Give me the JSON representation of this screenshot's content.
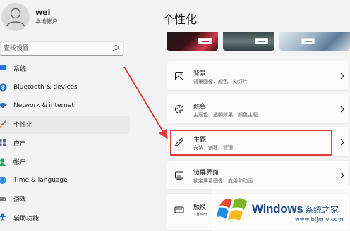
{
  "user": {
    "name": "wei",
    "account_type": "本地帐户"
  },
  "search": {
    "placeholder": "查找设置"
  },
  "sidebar": {
    "items": [
      {
        "label": "系统",
        "icon": "system-icon",
        "active": false
      },
      {
        "label": "Bluetooth & devices",
        "icon": "bluetooth-icon",
        "active": false
      },
      {
        "label": "Network & internet",
        "icon": "network-icon",
        "active": false
      },
      {
        "label": "个性化",
        "icon": "brush-icon",
        "active": true
      },
      {
        "label": "应用",
        "icon": "apps-icon",
        "active": false
      },
      {
        "label": "帐户",
        "icon": "account-icon",
        "active": false
      },
      {
        "label": "Time & language",
        "icon": "globe-icon",
        "active": false
      },
      {
        "label": "游戏",
        "icon": "gaming-icon",
        "active": false
      },
      {
        "label": "辅助功能",
        "icon": "accessibility-icon",
        "active": false
      }
    ]
  },
  "main": {
    "title": "个性化",
    "cards": [
      {
        "title": "背景",
        "subtitle": "背景图像、颜色、幻灯片",
        "icon": "image-icon"
      },
      {
        "title": "颜色",
        "subtitle": "主题色、透明效果、颜色主题",
        "icon": "palette-icon"
      },
      {
        "title": "主题",
        "subtitle": "安装、创建、管理",
        "icon": "pen-icon"
      },
      {
        "title": "锁屏界面",
        "subtitle": "锁定屏幕图像、应用和动画",
        "icon": "lockscreen-icon"
      },
      {
        "title": "触摸",
        "subtitle": "Them",
        "icon": "keyboard-icon"
      }
    ]
  },
  "watermark": {
    "brand": "Windows",
    "site_cn": "系统之家",
    "url": "www.bjjmlv.com"
  },
  "colors": {
    "accent_red": "#e0393e",
    "highlight_border": "#e0393e",
    "watermark_blue": "#1e4f8f",
    "background": "#f3f3f3",
    "card": "#fbfbfb"
  }
}
